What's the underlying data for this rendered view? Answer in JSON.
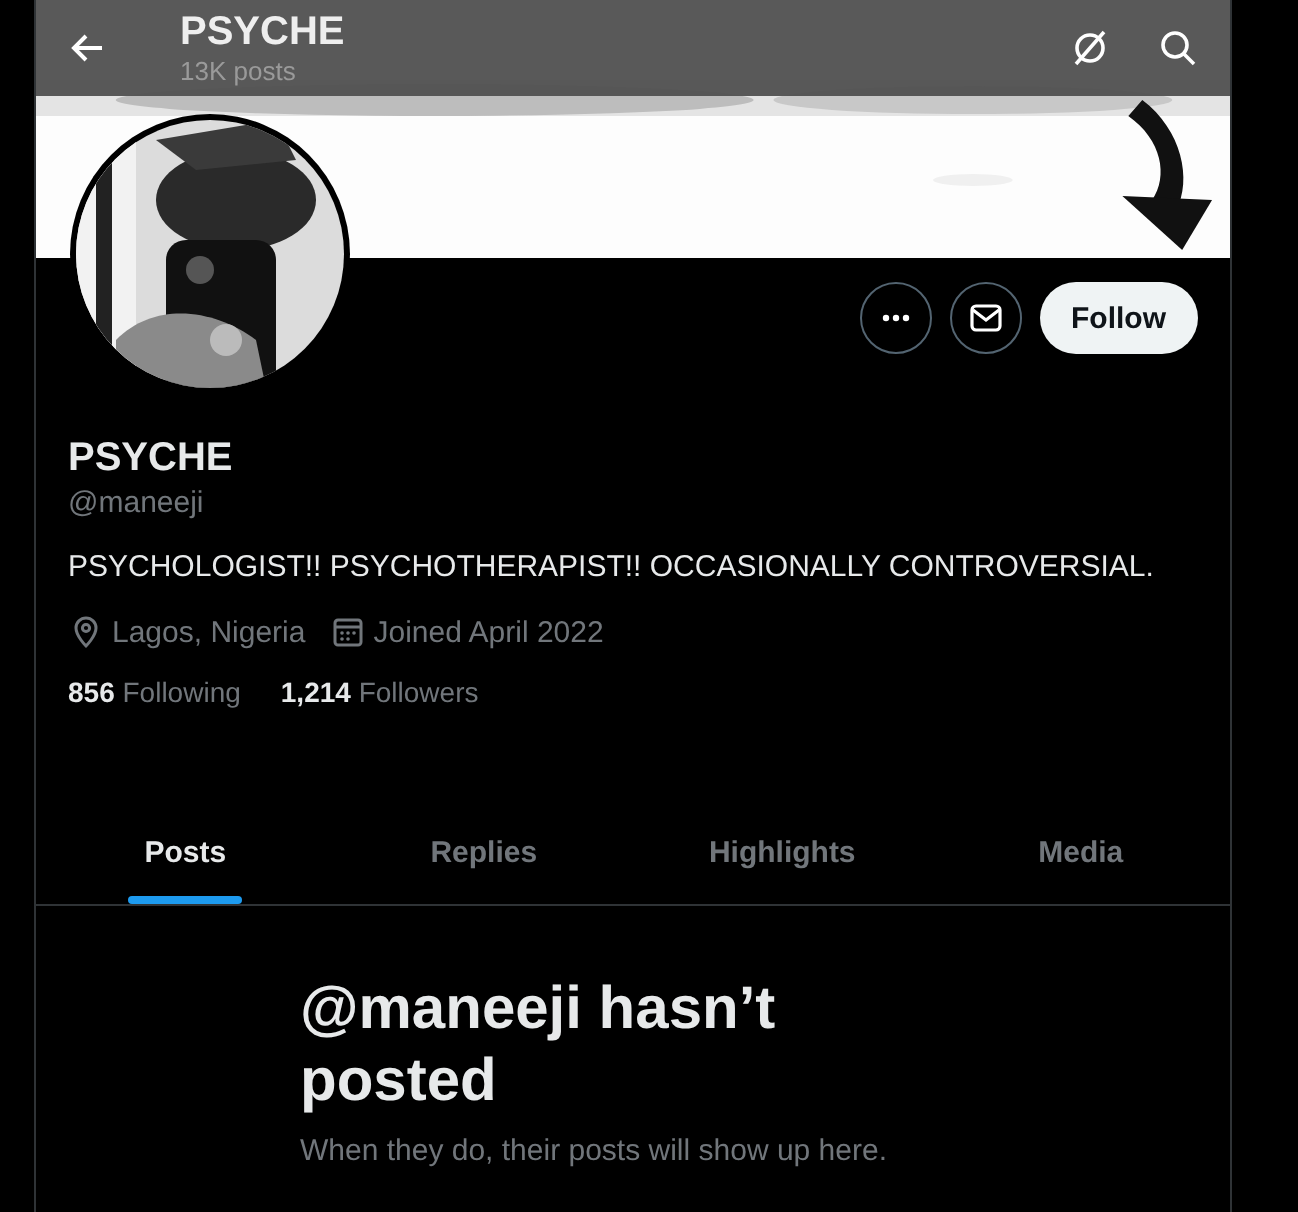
{
  "header": {
    "title": "PSYCHE",
    "subtitle": "13K posts"
  },
  "actions": {
    "follow_label": "Follow"
  },
  "profile": {
    "name": "PSYCHE",
    "handle": "@maneeji",
    "bio": "PSYCHOLOGIST!! PSYCHOTHERAPIST!! OCCASIONALLY CONTROVERSIAL.",
    "location": "Lagos, Nigeria",
    "joined": "Joined April 2022"
  },
  "stats": [
    {
      "count": "856",
      "label": "Following"
    },
    {
      "count": "1,214",
      "label": "Followers"
    }
  ],
  "tabs": [
    {
      "label": "Posts",
      "selected": true
    },
    {
      "label": "Replies",
      "selected": false
    },
    {
      "label": "Highlights",
      "selected": false
    },
    {
      "label": "Media",
      "selected": false
    }
  ],
  "empty_state": {
    "title": "@maneeji hasn’t posted",
    "subtitle": "When they do, their posts will show up here."
  }
}
